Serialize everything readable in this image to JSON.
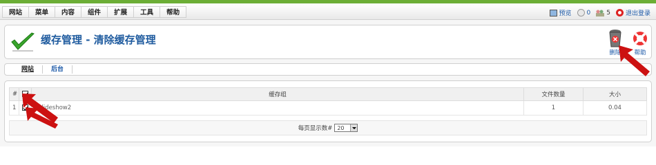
{
  "menubar": {
    "items": [
      "网站",
      "菜单",
      "内容",
      "组件",
      "扩展",
      "工具",
      "帮助"
    ]
  },
  "status": {
    "preview": "预览",
    "messages": "0",
    "users": "5",
    "logout": "退出登录"
  },
  "toolbar": {
    "title": "缓存管理 - 清除缓存管理",
    "delete_label": "删除",
    "help_label": "帮助"
  },
  "subnav": {
    "items": [
      "网站",
      "后台"
    ],
    "active": "网站"
  },
  "table": {
    "columns": [
      "#",
      "",
      "缓存组",
      "文件数量",
      "大小"
    ],
    "rows": [
      {
        "num": "1",
        "checked": true,
        "group": "slideshow2",
        "files": "1",
        "size": "0.04"
      }
    ]
  },
  "pagination": {
    "label": "每页显示数#",
    "per_page": "20"
  },
  "colors": {
    "accent_green": "#6cae36",
    "title_blue": "#1f5b9f",
    "arrow_red": "#cc1111"
  }
}
